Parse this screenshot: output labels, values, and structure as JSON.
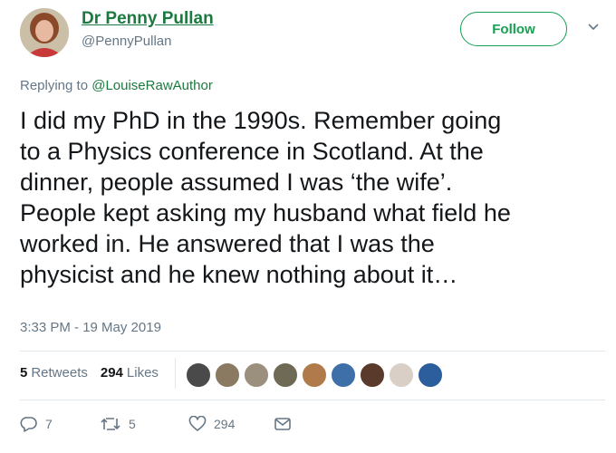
{
  "author": {
    "name": "Dr Penny Pullan",
    "handle": "@PennyPullan"
  },
  "follow_label": "Follow",
  "reply": {
    "prefix": "Replying to",
    "mention": "@LouiseRawAuthor"
  },
  "tweet_lines": [
    "I did my PhD in the 1990s. Remember going",
    "to a Physics conference in Scotland. At the",
    "dinner, people assumed I was ‘the wife’.",
    "People kept asking my husband what field he",
    "worked in. He answered that I was the",
    "physicist and he knew nothing about it…"
  ],
  "timestamp": "3:33 PM - 19 May 2019",
  "stats": {
    "retweets_count": "5",
    "retweets_label": "Retweets",
    "likes_count": "294",
    "likes_label": "Likes"
  },
  "liker_colors": [
    "#4a4a4a",
    "#8a7a62",
    "#9b8f7e",
    "#6f6a55",
    "#b07a4a",
    "#3f6fa8",
    "#5a3a2a",
    "#d9cfc6",
    "#2c5d9c"
  ],
  "actions": {
    "replies": "7",
    "retweets": "5",
    "likes": "294"
  },
  "colors": {
    "accent_green": "#17a050",
    "name_green": "#1b7a3f",
    "muted": "#657786"
  }
}
